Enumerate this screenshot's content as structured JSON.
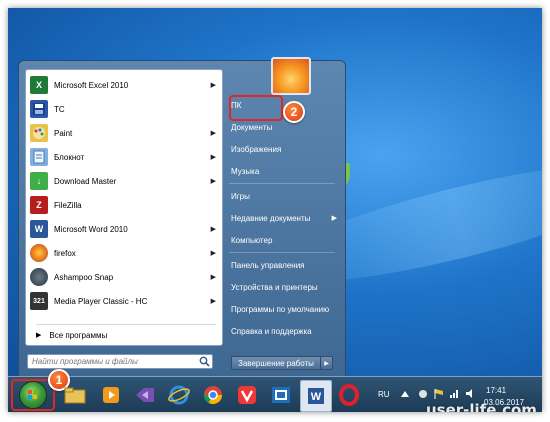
{
  "start_menu": {
    "programs": [
      {
        "label": "Microsoft Excel 2010",
        "icon": "excel-icon",
        "has_submenu": true
      },
      {
        "label": "TC",
        "icon": "save-icon",
        "has_submenu": false
      },
      {
        "label": "Paint",
        "icon": "paint-icon",
        "has_submenu": true
      },
      {
        "label": "Блокнот",
        "icon": "notepad-icon",
        "has_submenu": true
      },
      {
        "label": "Download Master",
        "icon": "download-master-icon",
        "has_submenu": true
      },
      {
        "label": "FileZilla",
        "icon": "filezilla-icon",
        "has_submenu": false
      },
      {
        "label": "Microsoft Word 2010",
        "icon": "word-icon",
        "has_submenu": true
      },
      {
        "label": "firefox",
        "icon": "firefox-icon",
        "has_submenu": true
      },
      {
        "label": "Ashampoo Snap",
        "icon": "ashampoo-snap-icon",
        "has_submenu": true
      },
      {
        "label": "Media Player Classic - HC",
        "icon": "media-player-classic-icon",
        "has_submenu": true
      }
    ],
    "all_programs_label": "Все программы",
    "search_placeholder": "Найти программы и файлы",
    "right_items": [
      {
        "label": "ПК",
        "has_submenu": false
      },
      {
        "label": "Документы",
        "has_submenu": false
      },
      {
        "label": "Изображения",
        "has_submenu": false
      },
      {
        "label": "Музыка",
        "has_submenu": false
      },
      {
        "label": "Игры",
        "has_submenu": false
      },
      {
        "label": "Недавние документы",
        "has_submenu": true
      },
      {
        "label": "Компьютер",
        "has_submenu": false
      },
      {
        "label": "Панель управления",
        "has_submenu": false
      },
      {
        "label": "Устройства и принтеры",
        "has_submenu": false
      },
      {
        "label": "Программы по умолчанию",
        "has_submenu": false
      },
      {
        "label": "Справка и поддержка",
        "has_submenu": false
      }
    ],
    "shutdown_label": "Завершение работы"
  },
  "annotations": {
    "badge_1": "1",
    "badge_2": "2",
    "highlight_color": "#e02727",
    "badge_color": "#e8501c"
  },
  "taskbar": {
    "pinned": [
      "explorer-icon",
      "media-player-icon",
      "visual-studio-icon",
      "internet-explorer-icon",
      "chrome-icon",
      "vivaldi-icon",
      "network-app-icon",
      "word-icon",
      "opera-icon"
    ],
    "language": "RU",
    "time": "17:41",
    "date": "03.06.2017"
  },
  "watermark": "user-life.com"
}
